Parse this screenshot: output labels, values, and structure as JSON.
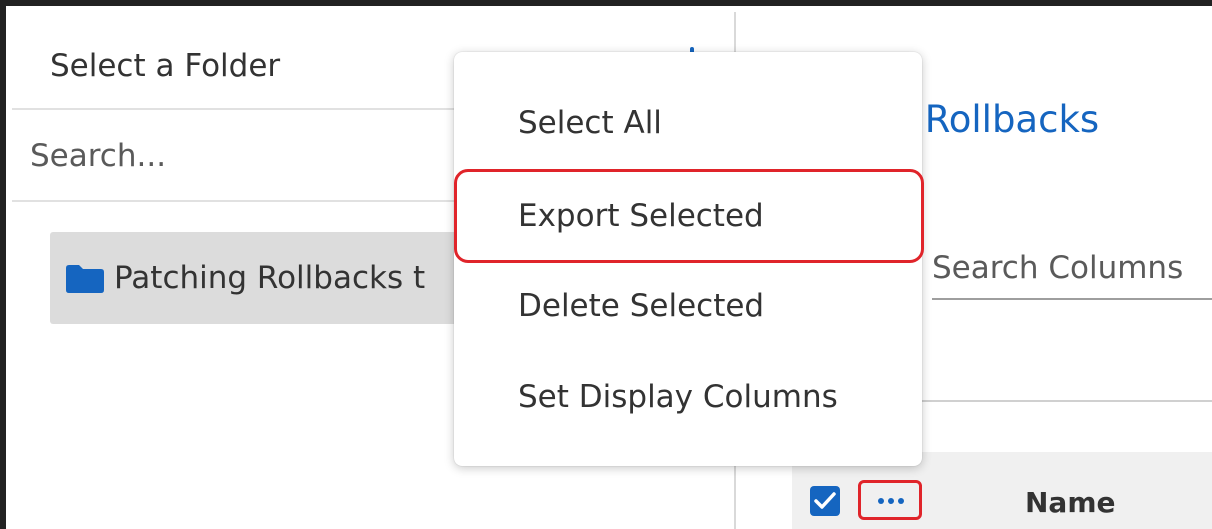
{
  "folder_panel": {
    "title": "Select a Folder",
    "search_placeholder": "Search...",
    "folders": [
      {
        "label": "Patching Rollbacks t",
        "icon": "folder-icon"
      }
    ]
  },
  "main": {
    "title": "ng Rollbacks",
    "column_search_placeholder": "Search Columns",
    "grid": {
      "select_all_checked": true,
      "more_icon": "more-horizontal-icon",
      "columns": [
        "Name"
      ]
    }
  },
  "context_menu": {
    "items": [
      {
        "label": "Select All",
        "highlighted": false
      },
      {
        "label": "Export Selected",
        "highlighted": true
      },
      {
        "label": "Delete Selected",
        "highlighted": false
      },
      {
        "label": "Set Display Columns",
        "highlighted": false
      }
    ]
  },
  "colors": {
    "accent": "#1565c0",
    "highlight_border": "#e0242a",
    "selected_row": "#dcdcdc",
    "grid_header": "#f0f0f0"
  }
}
